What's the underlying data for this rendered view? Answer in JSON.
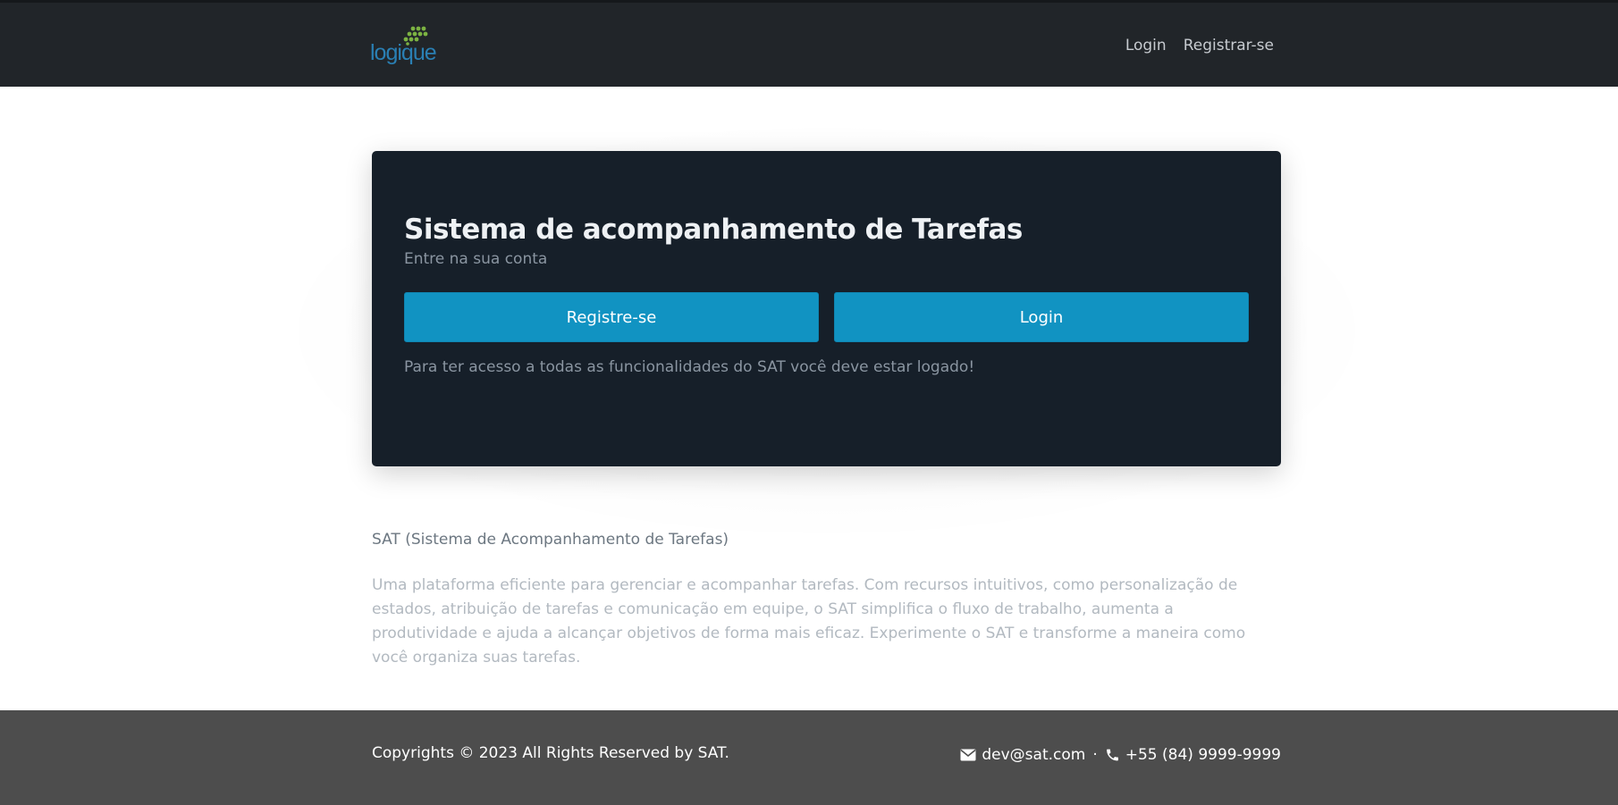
{
  "header": {
    "logo_text": "logique",
    "nav": [
      {
        "label": "Login"
      },
      {
        "label": "Registrar-se"
      }
    ]
  },
  "hero": {
    "title": "Sistema de acompanhamento de Tarefas",
    "subtitle": "Entre na sua conta",
    "register_label": "Registre-se",
    "login_label": "Login",
    "note": "Para ter acesso a todas as funcionalidades do SAT você deve estar logado!"
  },
  "about": {
    "title": "SAT (Sistema de Acompanhamento de Tarefas)",
    "body": "Uma plataforma eficiente para gerenciar e acompanhar tarefas. Com recursos intuitivos, como personalização de estados, atribuição de tarefas e comunicação em equipe, o SAT simplifica o fluxo de trabalho, aumenta a produtividade e ajuda a alcançar objetivos de forma mais eficaz. Experimente o SAT e transforme a maneira como você organiza suas tarefas."
  },
  "footer": {
    "copyright": "Copyrights © 2023 All Rights Reserved by SAT.",
    "email": "dev@sat.com",
    "separator": "·",
    "phone": "+55 (84) 9999-9999",
    "email_icon": "envelope-icon",
    "phone_icon": "phone-icon"
  },
  "colors": {
    "header_bg": "#212529",
    "hero_bg": "#161f29",
    "button_bg": "#1193c2",
    "footer_bg": "#4d4d4d",
    "logo_blue": "#2a7fb3",
    "logo_green": "#7cb342"
  }
}
